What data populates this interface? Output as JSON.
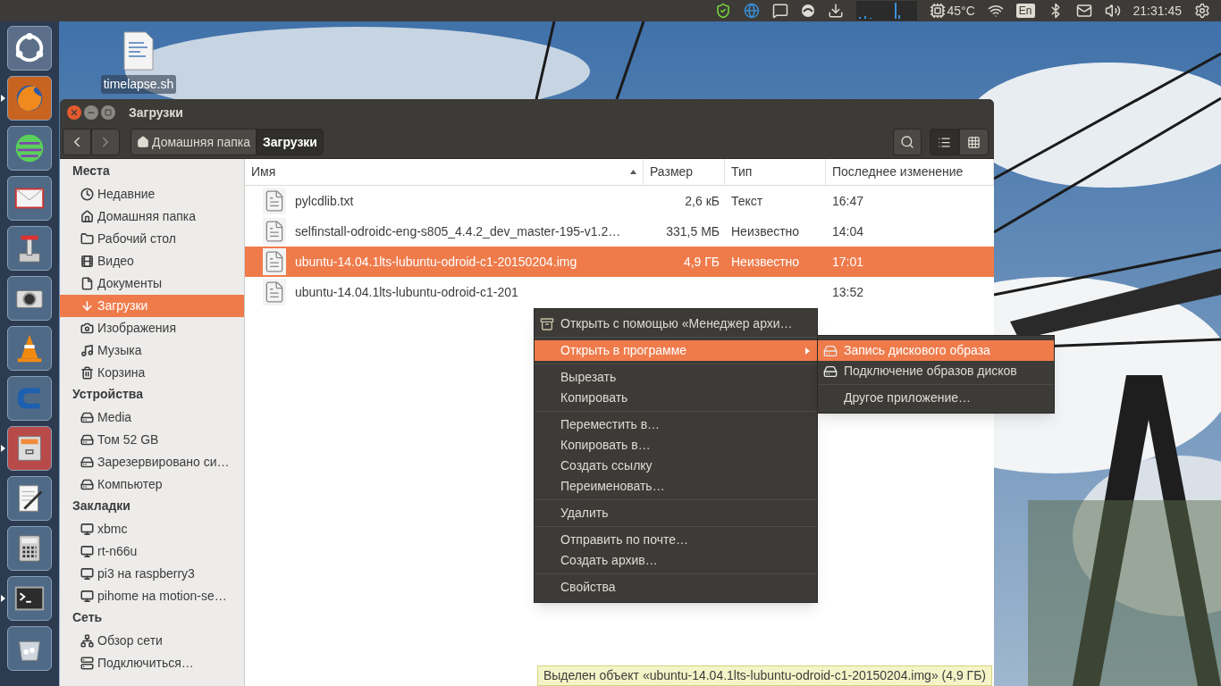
{
  "top_panel": {
    "temperature": "45°C",
    "keyboard_layout": "En",
    "clock": "21:31:45"
  },
  "launcher": [
    {
      "kind": "dash",
      "selected": false,
      "running": false
    },
    {
      "kind": "browser",
      "selected": false,
      "running": true
    },
    {
      "kind": "globe",
      "selected": false,
      "running": false
    },
    {
      "kind": "mail",
      "selected": false,
      "running": false
    },
    {
      "kind": "lever",
      "selected": false,
      "running": false
    },
    {
      "kind": "camera",
      "selected": false,
      "running": false
    },
    {
      "kind": "cone",
      "selected": false,
      "running": false
    },
    {
      "kind": "letter",
      "selected": false,
      "running": false
    },
    {
      "kind": "files",
      "selected": true,
      "running": true
    },
    {
      "kind": "editor",
      "selected": false,
      "running": false
    },
    {
      "kind": "calculator",
      "selected": false,
      "running": false
    },
    {
      "kind": "terminal",
      "selected": false,
      "running": true
    },
    {
      "kind": "trash",
      "selected": false,
      "running": false
    }
  ],
  "desktop_icons": [
    {
      "label": "timelapse.sh"
    }
  ],
  "window": {
    "title": "Загрузки",
    "breadcrumb": [
      {
        "label": "Домашняя папка",
        "kind": "home",
        "selected": false
      },
      {
        "label": "Загрузки",
        "kind": "folder",
        "selected": true
      }
    ],
    "view_modes": [
      {
        "kind": "list",
        "selected": true
      },
      {
        "kind": "grid",
        "selected": false
      }
    ],
    "sidebar": [
      {
        "title": "Места",
        "items": [
          {
            "label": "Недавние",
            "kind": "recent",
            "selected": false
          },
          {
            "label": "Домашняя папка",
            "kind": "home",
            "selected": false
          },
          {
            "label": "Рабочий стол",
            "kind": "desktop",
            "selected": false
          },
          {
            "label": "Видео",
            "kind": "video",
            "selected": false
          },
          {
            "label": "Документы",
            "kind": "documents",
            "selected": false
          },
          {
            "label": "Загрузки",
            "kind": "downloads",
            "selected": true
          },
          {
            "label": "Изображения",
            "kind": "pictures",
            "selected": false
          },
          {
            "label": "Музыка",
            "kind": "music",
            "selected": false
          },
          {
            "label": "Корзина",
            "kind": "trash",
            "selected": false
          }
        ]
      },
      {
        "title": "Устройства",
        "items": [
          {
            "label": "Media",
            "kind": "drive",
            "selected": false
          },
          {
            "label": "Том 52 GB",
            "kind": "drive",
            "selected": false
          },
          {
            "label": "Зарезервировано си…",
            "kind": "drive",
            "selected": false
          },
          {
            "label": "Компьютер",
            "kind": "drive",
            "selected": false
          }
        ]
      },
      {
        "title": "Закладки",
        "items": [
          {
            "label": "xbmc",
            "kind": "share",
            "selected": false
          },
          {
            "label": "rt-n66u",
            "kind": "share",
            "selected": false
          },
          {
            "label": "pi3 на raspberry3",
            "kind": "share",
            "selected": false
          },
          {
            "label": "pihome на motion-se…",
            "kind": "share",
            "selected": false
          }
        ]
      },
      {
        "title": "Сеть",
        "items": [
          {
            "label": "Обзор сети",
            "kind": "network",
            "selected": false
          },
          {
            "label": "Подключиться…",
            "kind": "connect",
            "selected": false
          }
        ]
      }
    ],
    "columns": [
      {
        "label": "Имя",
        "sorted": true
      },
      {
        "label": "Размер",
        "sorted": false
      },
      {
        "label": "Тип",
        "sorted": false
      },
      {
        "label": "Последнее изменение",
        "sorted": false
      }
    ],
    "rows": [
      {
        "name": "pylcdlib.txt",
        "size": "2,6 кБ",
        "type": "Текст",
        "modified": "16:47",
        "selected": false
      },
      {
        "name": "selfinstall-odroidc-eng-s805_4.4.2_dev_master-195-v1.2…",
        "size": "331,5 МБ",
        "type": "Неизвестно",
        "modified": "14:04",
        "selected": false
      },
      {
        "name": "ubuntu-14.04.1lts-lubuntu-odroid-c1-20150204.img",
        "size": "4,9 ГБ",
        "type": "Неизвестно",
        "modified": "17:01",
        "selected": true
      },
      {
        "name": "ubuntu-14.04.1lts-lubuntu-odroid-c1-201",
        "modified": "13:52",
        "selected": false
      }
    ],
    "status": "Выделен объект «ubuntu-14.04.1lts-lubuntu-odroid-c1-20150204.img» (4,9 ГБ)"
  },
  "context_menu": {
    "groups": [
      [
        {
          "label": "Открыть с помощью «Менеджер архи…",
          "kind": "archive",
          "submenu": false,
          "selected": false
        }
      ],
      [
        {
          "label": "Открыть в программе",
          "submenu": true,
          "selected": true
        }
      ],
      [
        {
          "label": "Вырезать",
          "submenu": false,
          "selected": false
        },
        {
          "label": "Копировать",
          "submenu": false,
          "selected": false
        }
      ],
      [
        {
          "label": "Переместить в…",
          "submenu": false,
          "selected": false
        },
        {
          "label": "Копировать в…",
          "submenu": false,
          "selected": false
        },
        {
          "label": "Создать ссылку",
          "submenu": false,
          "selected": false
        },
        {
          "label": "Переименовать…",
          "submenu": false,
          "selected": false
        }
      ],
      [
        {
          "label": "Удалить",
          "submenu": false,
          "selected": false
        }
      ],
      [
        {
          "label": "Отправить по почте…",
          "submenu": false,
          "selected": false
        },
        {
          "label": "Создать архив…",
          "submenu": false,
          "selected": false
        }
      ],
      [
        {
          "label": "Свойства",
          "submenu": false,
          "selected": false
        }
      ]
    ]
  },
  "submenu": {
    "groups": [
      [
        {
          "label": "Запись дискового образа",
          "kind": "drive",
          "selected": true
        },
        {
          "label": "Подключение образов дисков",
          "kind": "drive",
          "selected": false
        }
      ],
      [
        {
          "label": "Другое приложение…",
          "selected": false
        }
      ]
    ]
  }
}
